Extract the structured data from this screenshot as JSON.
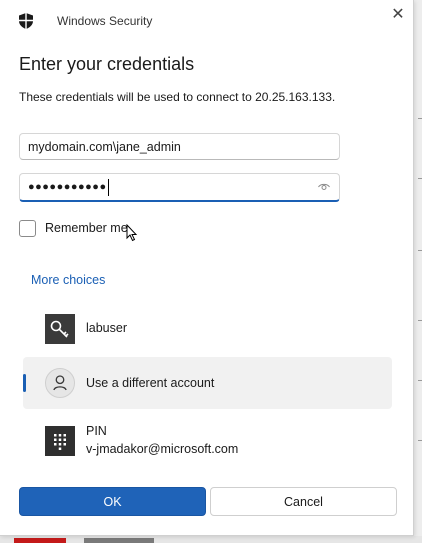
{
  "window": {
    "title": "Windows Security",
    "close_glyph": "✕"
  },
  "heading": "Enter your credentials",
  "description": "These credentials will be used to connect to 20.25.163.133.",
  "username_field": {
    "value": "mydomain.com\\jane_admin"
  },
  "password_field": {
    "masked_value": "●●●●●●●●●●●"
  },
  "remember_me": {
    "label": "Remember me",
    "checked": false
  },
  "more_choices_label": "More choices",
  "choices": [
    {
      "label": "labuser",
      "icon": "key-icon"
    },
    {
      "label": "Use a different account",
      "icon": "person-icon",
      "selected": true
    },
    {
      "label": "PIN",
      "sublabel": "v-jmadakor@microsoft.com",
      "icon": "keypad-icon"
    }
  ],
  "buttons": {
    "ok": "OK",
    "cancel": "Cancel"
  },
  "colors": {
    "accent": "#1f63b8",
    "link": "#1a5fb4",
    "selected_bg": "#f1f1f1"
  }
}
